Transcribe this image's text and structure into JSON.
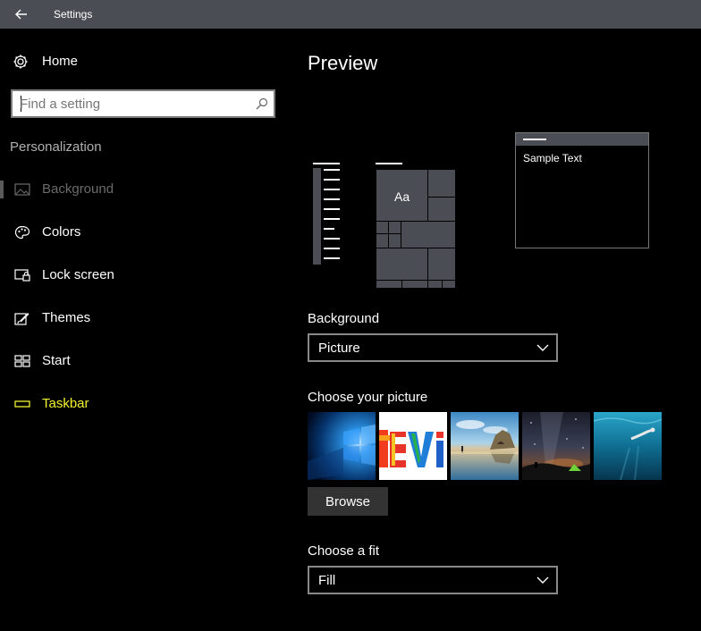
{
  "window": {
    "title": "Settings",
    "back_icon": "arrow-left-icon"
  },
  "sidebar": {
    "home_label": "Home",
    "home_icon": "gear-icon",
    "search": {
      "placeholder": "Find a setting",
      "value": "",
      "icon": "search-icon"
    },
    "section_title": "Personalization",
    "items": [
      {
        "label": "Background",
        "icon": "picture-icon",
        "selected": true
      },
      {
        "label": "Colors",
        "icon": "palette-icon"
      },
      {
        "label": "Lock screen",
        "icon": "lock-screen-icon"
      },
      {
        "label": "Themes",
        "icon": "brush-icon"
      },
      {
        "label": "Start",
        "icon": "start-tiles-icon"
      },
      {
        "label": "Taskbar",
        "icon": "taskbar-icon",
        "highlight_color": "#f3f32e"
      }
    ]
  },
  "main": {
    "heading": "Preview",
    "preview": {
      "tile_text": "Aa",
      "sample_text": "Sample Text"
    },
    "background": {
      "label": "Background",
      "value": "Picture"
    },
    "choose_picture": {
      "label": "Choose your picture",
      "thumbnails": [
        "windows-hero-thumb",
        "colorful-letters-thumb",
        "beach-rock-thumb",
        "night-sky-tent-thumb",
        "underwater-swimmer-thumb"
      ]
    },
    "browse_label": "Browse",
    "fit": {
      "label": "Choose a fit",
      "value": "Fill"
    }
  },
  "colors": {
    "titlebar": "#4a4e54",
    "background": "#000000",
    "accent": "#f3f32e",
    "tile": "#4a4e54"
  }
}
